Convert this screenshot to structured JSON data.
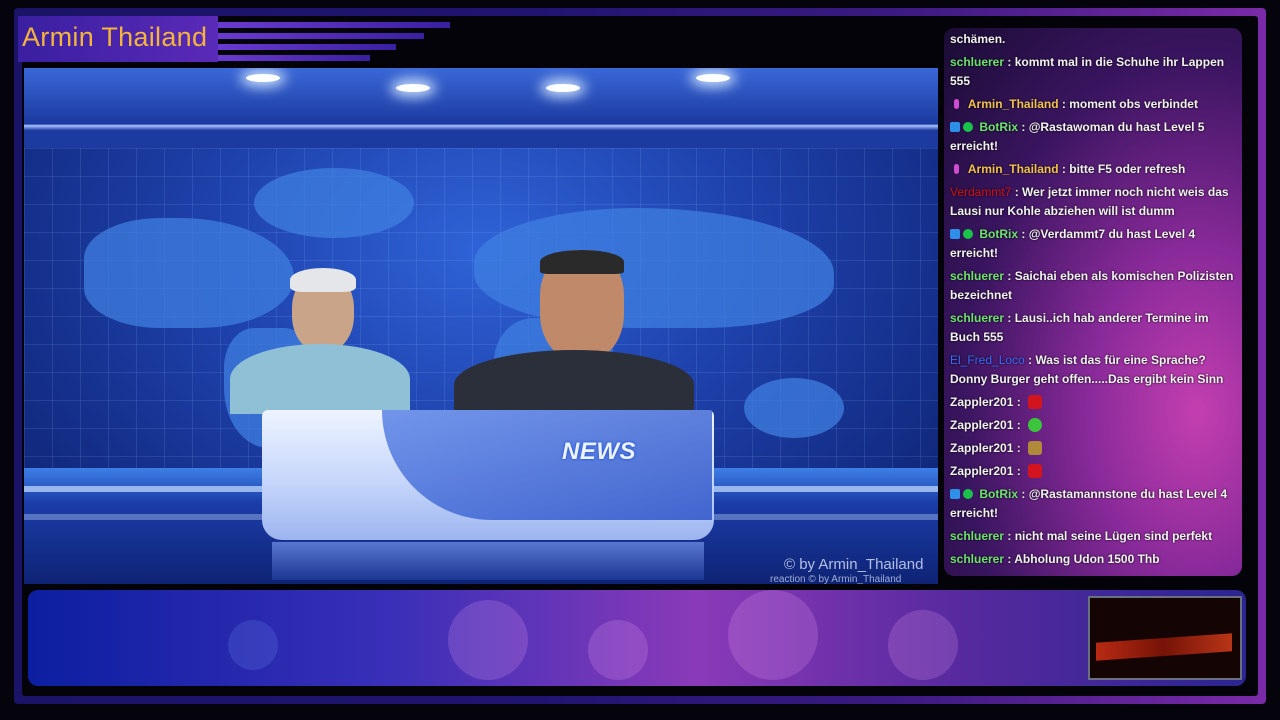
{
  "overlay": {
    "channel_title": "Armin Thailand",
    "desk_label": "NEWS",
    "watermark_main": "© by Armin_Thailand",
    "watermark_sub": "reaction  © by Armin_Thailand"
  },
  "colors": {
    "title": "#f4b43c",
    "user_green": "#6ee26e",
    "user_orange": "#f2c14e",
    "user_red": "#d2141e",
    "user_blue": "#3a6bff"
  },
  "chat": {
    "messages": [
      {
        "user": "",
        "text": "schämen."
      },
      {
        "user": "schluerer",
        "text": "kommt mal in die Schuhe ihr Lappen 555"
      },
      {
        "user": "Armin_Thailand",
        "text": "moment obs verbindet"
      },
      {
        "user": "BotRix",
        "text": "@Rastawoman du hast Level 5 erreicht!"
      },
      {
        "user": "Armin_Thailand",
        "text": "bitte F5 oder refresh"
      },
      {
        "user": "Verdammt7",
        "text": "Wer jetzt immer noch nicht weis das Lausi nur Kohle abziehen will ist dumm"
      },
      {
        "user": "BotRix",
        "text": "@Verdammt7 du hast Level 4 erreicht!"
      },
      {
        "user": "schluerer",
        "text": "Saichai eben als komischen Polizisten bezeichnet"
      },
      {
        "user": "schluerer",
        "text": "Lausi..ich hab anderer Termine im Buch 555"
      },
      {
        "user": "El_Fred_Loco",
        "text": "Was ist das für eine Sprache? Donny Burger geht offen.....Das ergibt kein Sinn"
      },
      {
        "user": "Zappler201",
        "text": ""
      },
      {
        "user": "Zappler201",
        "text": ""
      },
      {
        "user": "Zappler201",
        "text": ""
      },
      {
        "user": "Zappler201",
        "text": ""
      },
      {
        "user": "BotRix",
        "text": "@Rastamannstone du hast Level 4 erreicht!"
      },
      {
        "user": "schluerer",
        "text": "nicht mal seine Lügen sind perfekt"
      },
      {
        "user": "schluerer",
        "text": "Abholung Udon 1500 Thb"
      }
    ],
    "separator": ":"
  }
}
